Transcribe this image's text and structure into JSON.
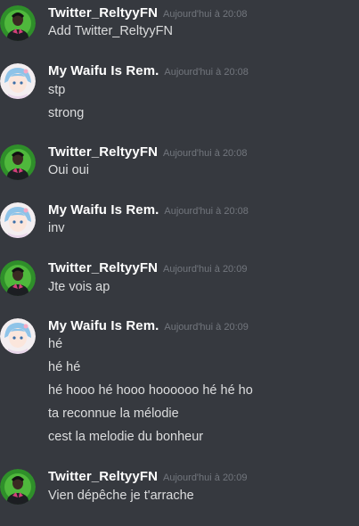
{
  "colors": {
    "background": "#36393f",
    "username": "#ffffff",
    "timestamp": "#72767d",
    "message_text": "#dcddde"
  },
  "messages": [
    {
      "author": "Twitter_ReltyyFN",
      "avatar_icon": "fortnite-skin-avatar-icon",
      "timestamp": "Aujourd'hui à 20:08",
      "lines": [
        "Add Twitter_ReltyyFN"
      ]
    },
    {
      "author": "My Waifu Is Rem.",
      "avatar_icon": "anime-girl-avatar-icon",
      "timestamp": "Aujourd'hui à 20:08",
      "lines": [
        "stp",
        "strong"
      ]
    },
    {
      "author": "Twitter_ReltyyFN",
      "avatar_icon": "fortnite-skin-avatar-icon",
      "timestamp": "Aujourd'hui à 20:08",
      "lines": [
        "Oui oui"
      ]
    },
    {
      "author": "My Waifu Is Rem.",
      "avatar_icon": "anime-girl-avatar-icon",
      "timestamp": "Aujourd'hui à 20:08",
      "lines": [
        "inv"
      ]
    },
    {
      "author": "Twitter_ReltyyFN",
      "avatar_icon": "fortnite-skin-avatar-icon",
      "timestamp": "Aujourd'hui à 20:09",
      "lines": [
        "Jte vois ap"
      ]
    },
    {
      "author": "My Waifu Is Rem.",
      "avatar_icon": "anime-girl-avatar-icon",
      "timestamp": "Aujourd'hui à 20:09",
      "lines": [
        "hé",
        "hé hé",
        "hé hooo hé hooo hoooooo hé hé ho",
        "ta reconnue la mélodie",
        "cest la melodie du bonheur"
      ]
    },
    {
      "author": "Twitter_ReltyyFN",
      "avatar_icon": "fortnite-skin-avatar-icon",
      "timestamp": "Aujourd'hui à 20:09",
      "lines": [
        "Vien dépêche je t'arrache"
      ]
    }
  ]
}
